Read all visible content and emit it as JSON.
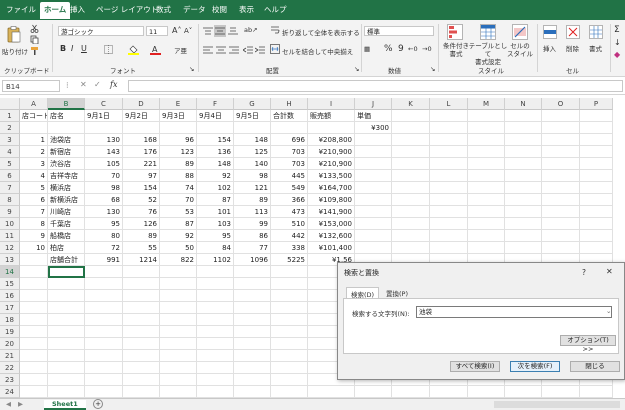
{
  "menu": {
    "tabs": [
      "ファイル",
      "ホーム",
      "挿入",
      "ページ レイアウト",
      "数式",
      "データ",
      "校閲",
      "表示",
      "ヘルプ"
    ],
    "active_tab": "ホーム"
  },
  "ribbon": {
    "paste_label": "貼り付け",
    "clipboard_label": "クリップボード",
    "font_name": "游ゴシック",
    "font_size": "11",
    "font_group_label": "フォント",
    "wrap_text_label": "折り返して全体を表示する",
    "merge_center_label": "セルを結合して中央揃え",
    "alignment_label": "配置",
    "number_format": "標準",
    "number_label": "数値",
    "conditional_format_label": "条件付き\n書式",
    "table_format_label": "テーブルとして\n書式設定",
    "cell_style_label": "セルの\nスタイル",
    "styles_label": "スタイル",
    "insert_label": "挿入",
    "delete_label": "削除",
    "format_label": "書式",
    "cells_label": "セル",
    "accent_color": "#217346"
  },
  "formula_bar": {
    "name_box": "B14",
    "fx_label": "fx",
    "value": ""
  },
  "sheet": {
    "columns": [
      "A",
      "B",
      "C",
      "D",
      "E",
      "F",
      "G",
      "H",
      "I",
      "J",
      "K",
      "L",
      "M",
      "N",
      "O",
      "P"
    ],
    "rows": [
      [
        "店コード",
        "店名",
        "9月1日",
        "9月2日",
        "9月3日",
        "9月4日",
        "9月5日",
        "合計数",
        "販売額",
        "単価",
        "",
        "",
        "",
        "",
        "",
        ""
      ],
      [
        "",
        "",
        "",
        "",
        "",
        "",
        "",
        "",
        "",
        "¥300",
        "",
        "",
        "",
        "",
        "",
        ""
      ],
      [
        "1",
        "池袋店",
        "130",
        "168",
        "96",
        "154",
        "148",
        "696",
        "¥208,800",
        "",
        "",
        "",
        "",
        "",
        "",
        ""
      ],
      [
        "2",
        "新宿店",
        "143",
        "176",
        "123",
        "136",
        "125",
        "703",
        "¥210,900",
        "",
        "",
        "",
        "",
        "",
        "",
        ""
      ],
      [
        "3",
        "渋谷店",
        "105",
        "221",
        "89",
        "148",
        "140",
        "703",
        "¥210,900",
        "",
        "",
        "",
        "",
        "",
        "",
        ""
      ],
      [
        "4",
        "吉祥寺店",
        "70",
        "97",
        "88",
        "92",
        "98",
        "445",
        "¥133,500",
        "",
        "",
        "",
        "",
        "",
        "",
        ""
      ],
      [
        "5",
        "横浜店",
        "98",
        "154",
        "74",
        "102",
        "121",
        "549",
        "¥164,700",
        "",
        "",
        "",
        "",
        "",
        "",
        ""
      ],
      [
        "6",
        "新横浜店",
        "68",
        "52",
        "70",
        "87",
        "89",
        "366",
        "¥109,800",
        "",
        "",
        "",
        "",
        "",
        "",
        ""
      ],
      [
        "7",
        "川崎店",
        "130",
        "76",
        "53",
        "101",
        "113",
        "473",
        "¥141,900",
        "",
        "",
        "",
        "",
        "",
        "",
        ""
      ],
      [
        "8",
        "千葉店",
        "95",
        "126",
        "87",
        "103",
        "99",
        "510",
        "¥153,000",
        "",
        "",
        "",
        "",
        "",
        "",
        ""
      ],
      [
        "9",
        "船橋店",
        "80",
        "89",
        "92",
        "95",
        "86",
        "442",
        "¥132,600",
        "",
        "",
        "",
        "",
        "",
        "",
        ""
      ],
      [
        "10",
        "柏店",
        "72",
        "55",
        "50",
        "84",
        "77",
        "338",
        "¥101,400",
        "",
        "",
        "",
        "",
        "",
        "",
        ""
      ],
      [
        "",
        "店舗合計",
        "991",
        "1214",
        "822",
        "1102",
        "1096",
        "5225",
        "¥1,56",
        "",
        "",
        "",
        "",
        "",
        "",
        ""
      ]
    ],
    "row_count": 24,
    "selected_cell": "B14"
  },
  "sheet_tabs": {
    "active": "Sheet1",
    "add_label": "+"
  },
  "dialog": {
    "title": "検索と置換",
    "help": "?",
    "close": "✕",
    "tab_find": "検索(D)",
    "tab_replace": "置換(P)",
    "find_label": "検索する文字列(N):",
    "find_value": "池袋",
    "options_button": "オプション(T) >>",
    "find_all_button": "すべて検索(I)",
    "find_next_button": "次を検索(F)",
    "close_button": "閉じる"
  }
}
